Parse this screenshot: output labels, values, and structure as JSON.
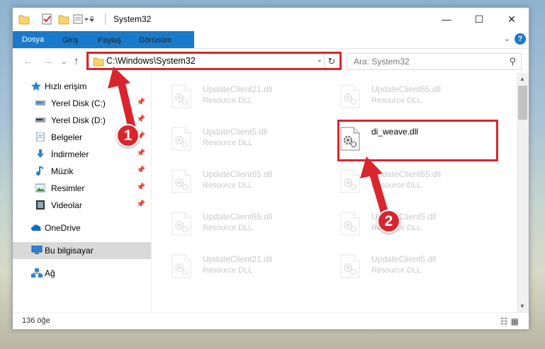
{
  "window": {
    "title": "System32",
    "minimize": "—",
    "maximize": "☐",
    "close": "✕"
  },
  "ribbon": {
    "tabs": [
      "Dosya",
      "Giriş",
      "Paylaş",
      "Görünüm"
    ],
    "help": "?"
  },
  "address": {
    "path": "C:\\Windows\\System32"
  },
  "search": {
    "placeholder": "Ara: System32"
  },
  "nav": {
    "items": [
      {
        "label": "Hızlı erişim",
        "icon": "star-icon",
        "pinned": false
      },
      {
        "label": "Yerel Disk (C:)",
        "icon": "drive-icon",
        "pinned": true
      },
      {
        "label": "Yerel Disk (D:)",
        "icon": "drive-icon",
        "pinned": true
      },
      {
        "label": "Belgeler",
        "icon": "documents-icon",
        "pinned": true
      },
      {
        "label": "İndirmeler",
        "icon": "download-icon",
        "pinned": true
      },
      {
        "label": "Müzik",
        "icon": "music-icon",
        "pinned": true
      },
      {
        "label": "Resimler",
        "icon": "pictures-icon",
        "pinned": true
      },
      {
        "label": "Videolar",
        "icon": "videos-icon",
        "pinned": true
      },
      {
        "label": "OneDrive",
        "icon": "cloud-icon",
        "pinned": false
      },
      {
        "label": "Bu bilgisayar",
        "icon": "computer-icon",
        "pinned": false,
        "selected": true
      },
      {
        "label": "Ağ",
        "icon": "network-icon",
        "pinned": false
      }
    ]
  },
  "files": [
    {
      "name": "UpdateClient21.dll",
      "type": "Resource DLL",
      "col": 0,
      "row": 0,
      "faded": true
    },
    {
      "name": "UpdateClient65.dll",
      "type": "Resource DLL",
      "col": 1,
      "row": 0,
      "faded": true
    },
    {
      "name": "UpdateClient5.dll",
      "type": "Resource DLL",
      "col": 0,
      "row": 1,
      "faded": true
    },
    {
      "name": "di_weave.dll",
      "type": "",
      "col": 1,
      "row": 1,
      "faded": false
    },
    {
      "name": "UpdateClient65.dll",
      "type": "Resource DLL",
      "col": 0,
      "row": 2,
      "faded": true
    },
    {
      "name": "UpdateClient65.dll",
      "type": "Resource DLL",
      "col": 1,
      "row": 2,
      "faded": true
    },
    {
      "name": "UpdateClient65.dll",
      "type": "Resource DLL",
      "col": 0,
      "row": 3,
      "faded": true
    },
    {
      "name": "UpdateClient5.dll",
      "type": "Resource DLL",
      "col": 1,
      "row": 3,
      "faded": true
    },
    {
      "name": "UpdateClient21.dll",
      "type": "Resource DLL",
      "col": 0,
      "row": 4,
      "faded": true
    },
    {
      "name": "UpdateClient5.dll",
      "type": "Resource DLL",
      "col": 1,
      "row": 4,
      "faded": true
    }
  ],
  "status": {
    "count": "136 öğe"
  },
  "callouts": [
    "1",
    "2"
  ],
  "colors": {
    "accent": "#1979ca",
    "annotation": "#d9262e"
  }
}
